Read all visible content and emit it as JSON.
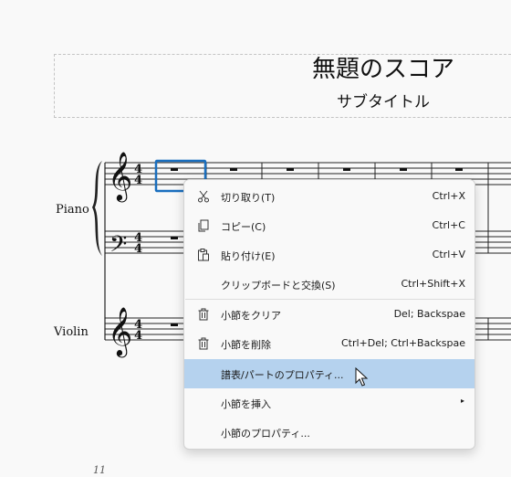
{
  "score": {
    "title": "無題のスコア",
    "subtitle": "サブタイトル",
    "page_number": "11",
    "instruments": [
      "Piano",
      "Violin"
    ],
    "selection_color": "#1a6fbf"
  },
  "context_menu": {
    "items": [
      {
        "icon": "scissors-icon",
        "label": "切り取り(T)",
        "shortcut": "Ctrl+X"
      },
      {
        "icon": "copy-icon",
        "label": "コピー(C)",
        "shortcut": "Ctrl+C"
      },
      {
        "icon": "paste-icon",
        "label": "貼り付け(E)",
        "shortcut": "Ctrl+V"
      },
      {
        "icon": "",
        "label": "クリップボードと交換(S)",
        "shortcut": "Ctrl+Shift+X"
      },
      {
        "icon": "trash-icon",
        "label": "小節をクリア",
        "shortcut": "Del; Backspae"
      },
      {
        "icon": "trash-icon",
        "label": "小節を削除",
        "shortcut": "Ctrl+Del; Ctrl+Backspae"
      },
      {
        "icon": "",
        "label": "譜表/パートのプロパティ...",
        "shortcut": ""
      },
      {
        "icon": "",
        "label": "小節を挿入",
        "shortcut": "",
        "submenu": "▸"
      },
      {
        "icon": "",
        "label": "小節のプロパティ...",
        "shortcut": ""
      }
    ],
    "highlighted_index": 6,
    "highlight_color": "#b5d2ee"
  }
}
